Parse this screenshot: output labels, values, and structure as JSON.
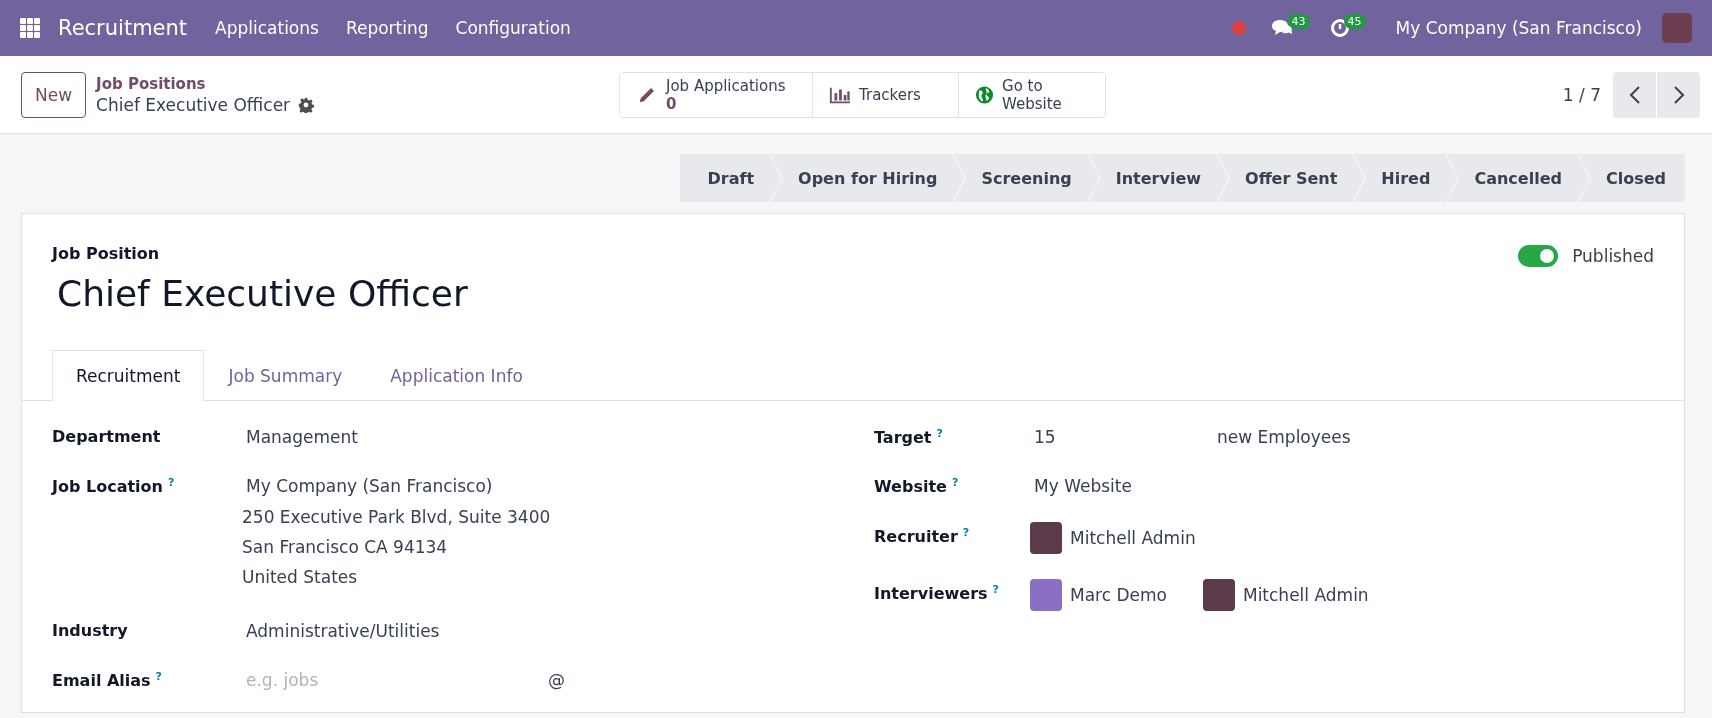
{
  "navbar": {
    "app_name": "Recruitment",
    "menus": [
      "Applications",
      "Reporting",
      "Configuration"
    ],
    "status_dot": {
      "color": "#d9423d"
    },
    "messages": {
      "count": "43"
    },
    "activities": {
      "count": "45"
    },
    "company": "My Company (San Francisco)"
  },
  "control_panel": {
    "new_button": "New",
    "breadcrumb": {
      "parent": "Job Positions",
      "current": "Chief Executive Officer"
    },
    "smart_buttons": [
      {
        "kind": "pencil",
        "label": "Job Applications",
        "value": "0"
      },
      {
        "kind": "chart",
        "label": "Trackers"
      },
      {
        "kind": "globe",
        "label": "Go to Website"
      }
    ],
    "pager": "1 / 7"
  },
  "statusbar": {
    "stages": [
      {
        "label": "Draft",
        "selected": false
      },
      {
        "label": "Open for Hiring",
        "selected": false
      },
      {
        "label": "Screening",
        "selected": false
      },
      {
        "label": "Interview",
        "selected": false
      },
      {
        "label": "Offer Sent",
        "selected": false
      },
      {
        "label": "Hired",
        "selected": false
      },
      {
        "label": "Cancelled",
        "selected": false
      },
      {
        "label": "Closed",
        "selected": false
      }
    ]
  },
  "form": {
    "title_label": "Job Position",
    "title": "Chief Executive Officer",
    "published": {
      "label": "Published",
      "on": true
    },
    "tabs": [
      {
        "label": "Recruitment",
        "selected": true
      },
      {
        "label": "Job Summary",
        "selected": false
      },
      {
        "label": "Application Info",
        "selected": false
      }
    ],
    "left_fields": [
      {
        "kind": "text",
        "label": "Department",
        "value": "Management"
      },
      {
        "kind": "address",
        "label": "Job Location",
        "help": "?",
        "value": "My Company (San Francisco)",
        "lines": [
          "250 Executive Park Blvd, Suite 3400",
          "San Francisco CA 94134",
          "United States"
        ]
      },
      {
        "kind": "text",
        "label": "Industry",
        "value": "Administrative/Utilities"
      },
      {
        "kind": "alias",
        "label": "Email Alias",
        "help": "?",
        "placeholder": "e.g. jobs",
        "suffix": "@"
      }
    ],
    "right_fields": [
      {
        "kind": "target",
        "label": "Target",
        "help": "?",
        "value": "15",
        "suffix": "new Employees"
      },
      {
        "kind": "text",
        "label": "Website",
        "help": "?",
        "value": "My Website"
      },
      {
        "kind": "users",
        "label": "Recruiter",
        "help": "?",
        "users": [
          {
            "name": "Mitchell Admin",
            "color": "#5b3a4a"
          }
        ]
      },
      {
        "kind": "users",
        "label": "Interviewers",
        "help": "?",
        "users": [
          {
            "name": "Marc Demo",
            "color": "#8a6fc4"
          },
          {
            "name": "Mitchell Admin",
            "color": "#5b3a4a"
          }
        ]
      }
    ]
  }
}
